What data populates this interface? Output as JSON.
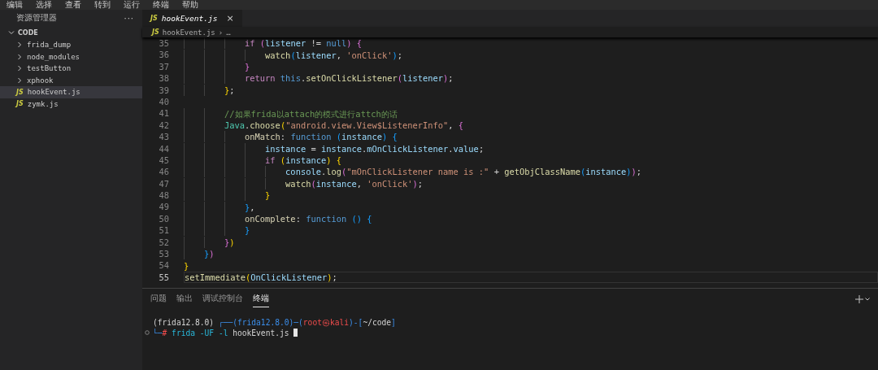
{
  "menu_bar": [
    "编辑",
    "选择",
    "查看",
    "转到",
    "运行",
    "终端",
    "帮助"
  ],
  "sidebar": {
    "title": "资源管理器",
    "more": "···",
    "root": {
      "label": "CODE",
      "expanded": true
    },
    "items": [
      {
        "kind": "folder",
        "label": "frida_dump",
        "selected": false
      },
      {
        "kind": "folder",
        "label": "node_modules",
        "selected": false
      },
      {
        "kind": "folder",
        "label": "testButton",
        "selected": false
      },
      {
        "kind": "folder",
        "label": "xphook",
        "selected": false
      },
      {
        "kind": "file",
        "badge": "JS",
        "label": "hookEvent.js",
        "selected": true
      },
      {
        "kind": "file",
        "badge": "JS",
        "label": "zymk.js",
        "selected": false
      }
    ]
  },
  "editor_tabs": [
    {
      "badge": "JS",
      "label": "hookEvent.js",
      "close": "×",
      "selected": true
    }
  ],
  "breadcrumb": {
    "badge": "JS",
    "file": "hookEvent.js",
    "separator": "›",
    "rest": "…"
  },
  "code_lines": [
    {
      "number": "35",
      "current": false,
      "tokens": [
        {
          "kind": "ctrl",
          "text": "            if "
        },
        {
          "kind": "b2",
          "text": "("
        },
        {
          "kind": "var",
          "text": "listener"
        },
        {
          "kind": "plain",
          "text": " != "
        },
        {
          "kind": "kw",
          "text": "null"
        },
        {
          "kind": "b2",
          "text": ") {"
        }
      ]
    },
    {
      "number": "36",
      "current": false,
      "tokens": [
        {
          "kind": "fn",
          "text": "                watch"
        },
        {
          "kind": "b3",
          "text": "("
        },
        {
          "kind": "var",
          "text": "listener"
        },
        {
          "kind": "plain",
          "text": ", "
        },
        {
          "kind": "str",
          "text": "'onClick'"
        },
        {
          "kind": "b3",
          "text": ")"
        },
        {
          "kind": "plain",
          "text": ";"
        }
      ]
    },
    {
      "number": "37",
      "current": false,
      "tokens": [
        {
          "kind": "b2",
          "text": "            }"
        }
      ]
    },
    {
      "number": "38",
      "current": false,
      "tokens": [
        {
          "kind": "ctrl",
          "text": "            return "
        },
        {
          "kind": "kw",
          "text": "this"
        },
        {
          "kind": "plain",
          "text": "."
        },
        {
          "kind": "fn",
          "text": "setOnClickListener"
        },
        {
          "kind": "b2",
          "text": "("
        },
        {
          "kind": "var",
          "text": "listener"
        },
        {
          "kind": "b2",
          "text": ")"
        },
        {
          "kind": "plain",
          "text": ";"
        }
      ]
    },
    {
      "number": "39",
      "current": false,
      "tokens": [
        {
          "kind": "b1",
          "text": "        }"
        },
        {
          "kind": "plain",
          "text": ";"
        }
      ]
    },
    {
      "number": "40",
      "current": false
    },
    {
      "number": "41",
      "current": false,
      "tokens": [
        {
          "kind": "com",
          "text": "        //如果frida以attach的模式进行attch的话"
        }
      ]
    },
    {
      "number": "42",
      "current": false,
      "tokens": [
        {
          "kind": "cls",
          "text": "        Java"
        },
        {
          "kind": "plain",
          "text": "."
        },
        {
          "kind": "fn",
          "text": "choose"
        },
        {
          "kind": "b1",
          "text": "("
        },
        {
          "kind": "str",
          "text": "\"android.view.View$ListenerInfo\""
        },
        {
          "kind": "plain",
          "text": ", "
        },
        {
          "kind": "b2",
          "text": "{"
        }
      ]
    },
    {
      "number": "43",
      "current": false,
      "tokens": [
        {
          "kind": "prop",
          "text": "            onMatch"
        },
        {
          "kind": "plain",
          "text": ": "
        },
        {
          "kind": "kw",
          "text": "function "
        },
        {
          "kind": "b3",
          "text": "("
        },
        {
          "kind": "var",
          "text": "instance"
        },
        {
          "kind": "b3",
          "text": ") {"
        }
      ]
    },
    {
      "number": "44",
      "current": false,
      "tokens": [
        {
          "kind": "var",
          "text": "                instance"
        },
        {
          "kind": "plain",
          "text": " = "
        },
        {
          "kind": "var",
          "text": "instance"
        },
        {
          "kind": "plain",
          "text": "."
        },
        {
          "kind": "var",
          "text": "mOnClickListener"
        },
        {
          "kind": "plain",
          "text": "."
        },
        {
          "kind": "var",
          "text": "value"
        },
        {
          "kind": "plain",
          "text": ";"
        }
      ]
    },
    {
      "number": "45",
      "current": false,
      "tokens": [
        {
          "kind": "ctrl",
          "text": "                if "
        },
        {
          "kind": "b1",
          "text": "("
        },
        {
          "kind": "var",
          "text": "instance"
        },
        {
          "kind": "b1",
          "text": ") {"
        }
      ]
    },
    {
      "number": "46",
      "current": false,
      "tokens": [
        {
          "kind": "var",
          "text": "                    console"
        },
        {
          "kind": "plain",
          "text": "."
        },
        {
          "kind": "fn",
          "text": "log"
        },
        {
          "kind": "b2",
          "text": "("
        },
        {
          "kind": "str",
          "text": "\"mOnClickListener name is :\""
        },
        {
          "kind": "plain",
          "text": " + "
        },
        {
          "kind": "fn",
          "text": "getObjClassName"
        },
        {
          "kind": "b3",
          "text": "("
        },
        {
          "kind": "var",
          "text": "instance"
        },
        {
          "kind": "b3",
          "text": ")"
        },
        {
          "kind": "b2",
          "text": ")"
        },
        {
          "kind": "plain",
          "text": ";"
        }
      ]
    },
    {
      "number": "47",
      "current": false,
      "tokens": [
        {
          "kind": "fn",
          "text": "                    watch"
        },
        {
          "kind": "b2",
          "text": "("
        },
        {
          "kind": "var",
          "text": "instance"
        },
        {
          "kind": "plain",
          "text": ", "
        },
        {
          "kind": "str",
          "text": "'onClick'"
        },
        {
          "kind": "b2",
          "text": ")"
        },
        {
          "kind": "plain",
          "text": ";"
        }
      ]
    },
    {
      "number": "48",
      "current": false,
      "tokens": [
        {
          "kind": "b1",
          "text": "                }"
        }
      ]
    },
    {
      "number": "49",
      "current": false,
      "tokens": [
        {
          "kind": "b3",
          "text": "            }"
        },
        {
          "kind": "plain",
          "text": ","
        }
      ]
    },
    {
      "number": "50",
      "current": false,
      "tokens": [
        {
          "kind": "prop",
          "text": "            onComplete"
        },
        {
          "kind": "plain",
          "text": ": "
        },
        {
          "kind": "kw",
          "text": "function "
        },
        {
          "kind": "b3",
          "text": "() {"
        }
      ]
    },
    {
      "number": "51",
      "current": false,
      "tokens": [
        {
          "kind": "b3",
          "text": "            }"
        }
      ]
    },
    {
      "number": "52",
      "current": false,
      "tokens": [
        {
          "kind": "b2",
          "text": "        }"
        },
        {
          "kind": "b1",
          "text": ")"
        }
      ]
    },
    {
      "number": "53",
      "current": false,
      "tokens": [
        {
          "kind": "b3",
          "text": "    }"
        },
        {
          "kind": "b2",
          "text": ")"
        }
      ]
    },
    {
      "number": "54",
      "current": false,
      "tokens": [
        {
          "kind": "b1",
          "text": "}"
        }
      ]
    },
    {
      "number": "55",
      "current": true,
      "tokens": [
        {
          "kind": "fn",
          "text": "setImmediate"
        },
        {
          "kind": "b1",
          "text": "("
        },
        {
          "kind": "var",
          "text": "OnClickListener"
        },
        {
          "kind": "b1",
          "text": ")"
        },
        {
          "kind": "plain",
          "text": ";"
        }
      ]
    }
  ],
  "panel": {
    "tabs": [
      {
        "label": "问题",
        "selected": false
      },
      {
        "label": "输出",
        "selected": false
      },
      {
        "label": "调试控制台",
        "selected": false
      },
      {
        "label": "终端",
        "selected": true
      }
    ],
    "terminal_lines": [
      {
        "prompt_dot": false,
        "segments": [
          {
            "kind": "plain",
            "text": "(frida12.8.0) "
          },
          {
            "kind": "blue",
            "text": "┌──(frida12.8.0)─("
          },
          {
            "kind": "red",
            "text": "root㉿kali"
          },
          {
            "kind": "blue",
            "text": ")-["
          },
          {
            "kind": "plain",
            "text": "~/code"
          },
          {
            "kind": "blue",
            "text": "]"
          }
        ]
      },
      {
        "prompt_dot": true,
        "cursor": true,
        "segments": [
          {
            "kind": "blue",
            "text": "└─"
          },
          {
            "kind": "red",
            "text": "#"
          },
          {
            "kind": "cyan",
            "text": " frida -UF -l"
          },
          {
            "kind": "plain",
            "text": " hookEvent.js "
          }
        ]
      }
    ]
  }
}
